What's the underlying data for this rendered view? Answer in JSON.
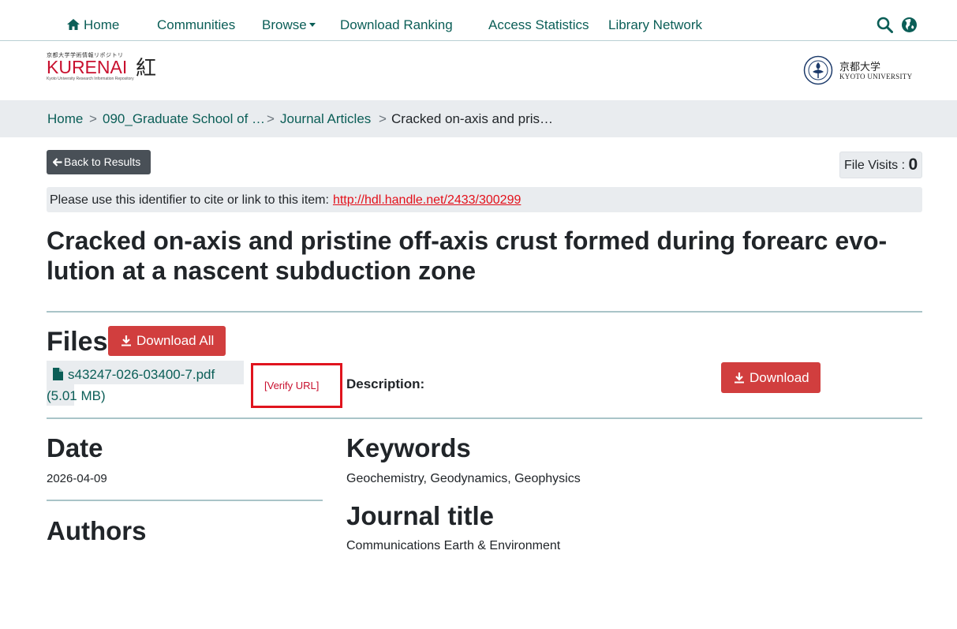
{
  "nav": {
    "home": "Home",
    "communities": "Communities",
    "browse": "Browse",
    "download_ranking": "Download Ranking",
    "access_statistics": "Access Statistics",
    "library_network": "Library Network"
  },
  "logo": {
    "kurenai_small": "京都大学学術情報リポジトリ",
    "kurenai": "KURENAI",
    "kurenai_kanji": "紅",
    "kurenai_sub": "Kyoto University Research Information Repository",
    "kyoto_jp": "京都大学",
    "kyoto_en": "KYOTO UNIVERSITY"
  },
  "breadcrumb": {
    "home": "Home",
    "sep": ">",
    "school": "090_Graduate School of …",
    "collection": "Journal Articles",
    "current": "Cracked on-axis and pris…"
  },
  "back_label": "Back to Results",
  "file_visits": {
    "label": "File Visits :",
    "count": "0"
  },
  "identifier": {
    "text": "Please use this identifier to cite or link to this item:",
    "url": "http://hdl.handle.net/2433/300299"
  },
  "title": "Cracked on-axis and pristine off-axis crust formed during forearc evo-lution at a nascent subduction zone",
  "files": {
    "heading": "Files",
    "download_all": "Download All",
    "file_name": "s43247-026-03400-7.pdf (5.01 MB)",
    "verify": "[Verify URL]",
    "description_label": "Description:",
    "download": "Download"
  },
  "metadata": {
    "date_heading": "Date",
    "date_value": "2026-04-09",
    "authors_heading": "Authors",
    "keywords_heading": "Keywords",
    "keywords_value": "Geochemistry, Geodynamics, Geophysics",
    "journal_heading": "Journal title",
    "journal_value": "Communications Earth & Environment"
  },
  "colors": {
    "link": "#0b5e57",
    "danger": "#d13e3e",
    "url_red": "#e3101a",
    "muted_bg": "#e9ecef",
    "divider": "#a9c4c8"
  }
}
